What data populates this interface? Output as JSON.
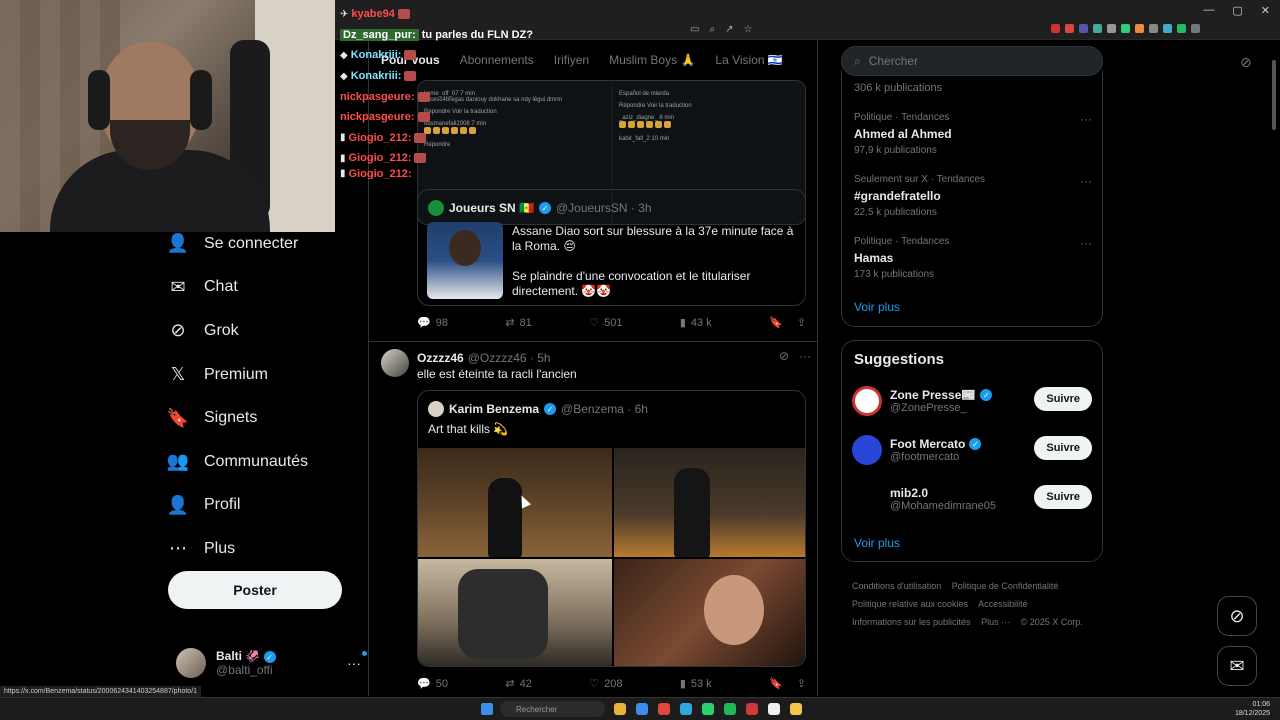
{
  "chat": [
    {
      "user": "kyabe94",
      "text": ""
    },
    {
      "user": "Dz_sang_pur:",
      "text": "tu parles du FLN DZ?"
    },
    {
      "user": "Konakriii:",
      "text": ""
    },
    {
      "user": "Konakriii:",
      "text": ""
    },
    {
      "user": "nickpasgeure:",
      "text": ""
    },
    {
      "user": "nickpasgeure:",
      "text": ""
    },
    {
      "user": "Giogio_212:",
      "text": ""
    },
    {
      "user": "Giogio_212:",
      "text": ""
    },
    {
      "user": "Giogio_212:",
      "text": ""
    }
  ],
  "nav": {
    "items": [
      {
        "label": "Se connecter",
        "icon": "person-plus-icon"
      },
      {
        "label": "Chat",
        "icon": "mail-icon"
      },
      {
        "label": "Grok",
        "icon": "grok-icon"
      },
      {
        "label": "Premium",
        "icon": "x-logo-icon"
      },
      {
        "label": "Signets",
        "icon": "bookmark-icon"
      },
      {
        "label": "Communautés",
        "icon": "communities-icon"
      },
      {
        "label": "Profil",
        "icon": "profile-icon"
      },
      {
        "label": "Plus",
        "icon": "more-circle-icon"
      }
    ],
    "post_label": "Poster"
  },
  "account": {
    "name": "Balti 🦑",
    "handle": "@balti_offi"
  },
  "tabs": [
    {
      "label": "Pour vous",
      "active": true
    },
    {
      "label": "Abonnements",
      "active": false
    },
    {
      "label": "Irifiyen",
      "active": false
    },
    {
      "label": "Muslim Boys 🙏",
      "active": false
    },
    {
      "label": "La Vision 🇮🇱",
      "active": false
    }
  ],
  "screenshot_preview": {
    "left": [
      {
        "user": "kame_off_07 7 min",
        "text": "@cesc4bregas daniouy dokhane sa ndy légui dmrm"
      },
      {
        "user": "Répondre",
        "text": "Voir la traduction"
      },
      {
        "user": "ousmanefall2008 7 min",
        "text": ""
      },
      {
        "user": "Répondre",
        "text": ""
      }
    ],
    "right": [
      {
        "user": "Español de mierda",
        "text": ""
      },
      {
        "user": "Répondre",
        "text": "Voir la traduction"
      },
      {
        "user": "_aziz_diagne_ 8 min",
        "text": ""
      },
      {
        "user": "kabir_fall_2 10 min",
        "text": ""
      }
    ]
  },
  "quote1": {
    "name": "Joueurs SN 🇸🇳",
    "handle": "@JoueursSN · 3h",
    "text1": "Assane Diao sort sur blessure à la 37e minute face à la Roma. 😔",
    "text2": "Se plaindre d'une convocation et le titulariser directement. 🤡🤡"
  },
  "actions1": {
    "replies": "98",
    "reposts": "81",
    "likes": "501",
    "views": "43 k"
  },
  "tweet2": {
    "name": "Ozzzz46",
    "handle": "@Ozzzz46 · 5h",
    "text": "elle est éteinte ta racli l'ancien"
  },
  "quote2": {
    "name": "Karim Benzema",
    "handle": "@Benzema · 6h",
    "text": "Art that kills 💫"
  },
  "actions2": {
    "replies": "50",
    "reposts": "42",
    "likes": "208",
    "views": "53 k"
  },
  "search": {
    "placeholder": "Chercher"
  },
  "trends": {
    "top_count": "306 k publications",
    "items": [
      {
        "category": "Politique · Tendances",
        "title": "Ahmed al Ahmed",
        "count": "97,9 k publications"
      },
      {
        "category": "Seulement sur X · Tendances",
        "title": "#grandefratello",
        "count": "22,5 k publications"
      },
      {
        "category": "Politique · Tendances",
        "title": "Hamas",
        "count": "173 k publications"
      }
    ],
    "see_more": "Voir plus"
  },
  "suggestions": {
    "title": "Suggestions",
    "items": [
      {
        "name": "Zone Presse📰",
        "handle": "@ZonePresse_",
        "follow": "Suivre",
        "verified": true,
        "color": "#ffffff"
      },
      {
        "name": "Foot Mercato",
        "handle": "@footmercato",
        "follow": "Suivre",
        "verified": true,
        "color": "#2946d6"
      },
      {
        "name": "mib2.0",
        "handle": "@Mohamedimrane05",
        "follow": "Suivre",
        "verified": false,
        "color": "#000000"
      }
    ],
    "see_more": "Voir plus"
  },
  "footer": {
    "links": [
      "Conditions d'utilisation",
      "Politique de Confidentialité",
      "Politique relative aux cookies",
      "Accessibilité",
      "Informations sur les publicités",
      "Plus ···"
    ],
    "copyright": "© 2025 X Corp."
  },
  "status_url": "https://x.com/Benzema/status/2000624341403254887/photo/1",
  "taskbar": {
    "search": "Rechercher",
    "time": "01:06",
    "date": "18/12/2025"
  },
  "colors": {
    "accent": "#1d9bf0",
    "bg": "#000000"
  }
}
